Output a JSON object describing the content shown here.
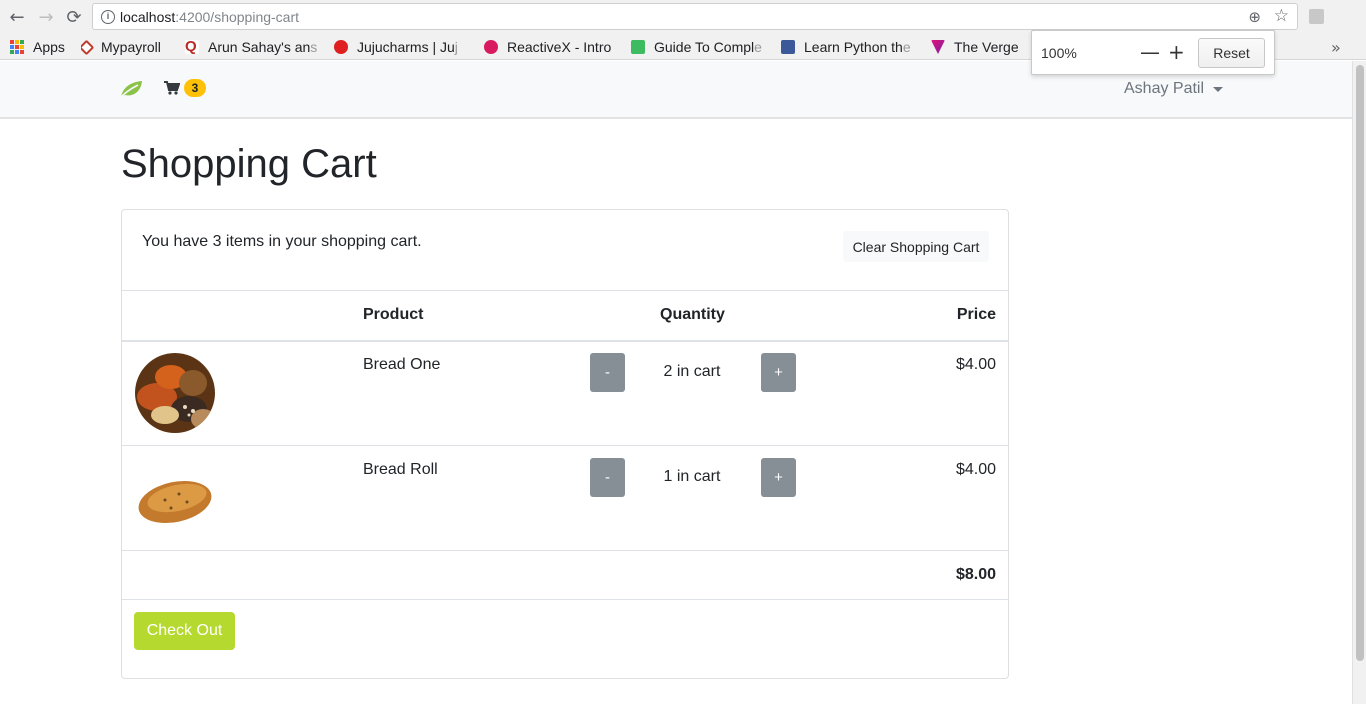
{
  "browser": {
    "url_host": "localhost",
    "url_path": ":4200/shopping-cart",
    "nav_back": "←",
    "nav_forward": "→",
    "nav_reload": "⟳",
    "zoom_glyph": "⊕",
    "star_glyph": "☆",
    "more_glyph": "»"
  },
  "bookmarks": [
    {
      "label": "Apps",
      "fade": ""
    },
    {
      "label": "Mypayroll",
      "fade": ""
    },
    {
      "label": "Arun Sahay's an",
      "fade": "s"
    },
    {
      "label": "Jujucharms | Ju",
      "fade": "j"
    },
    {
      "label": "ReactiveX - Intro",
      "fade": ""
    },
    {
      "label": "Guide To Compl",
      "fade": "e"
    },
    {
      "label": "Learn Python th",
      "fade": "e"
    },
    {
      "label": "The Verge",
      "fade": ""
    }
  ],
  "zoom_popup": {
    "percent": "100%",
    "minus": "—",
    "plus": "+",
    "reset_label": "Reset"
  },
  "navbar": {
    "cart_count": "3",
    "user_name": "Ashay Patil"
  },
  "page": {
    "title": "Shopping Cart",
    "message": "You have 3 items in your shopping cart.",
    "clear_label": "Clear Shopping Cart",
    "headers": {
      "product": "Product",
      "quantity": "Quantity",
      "price": "Price"
    },
    "items": [
      {
        "name": "Bread One",
        "quantity_text": "2 in cart",
        "price": "$4.00",
        "minus": "-",
        "plus": "+"
      },
      {
        "name": "Bread Roll",
        "quantity_text": "1 in cart",
        "price": "$4.00",
        "minus": "-",
        "plus": "+"
      }
    ],
    "total": "$8.00",
    "checkout_label": "Check Out"
  },
  "colors": {
    "checkout": "#b5d92e",
    "badge": "#ffc107",
    "qty_button": "#868e96"
  }
}
